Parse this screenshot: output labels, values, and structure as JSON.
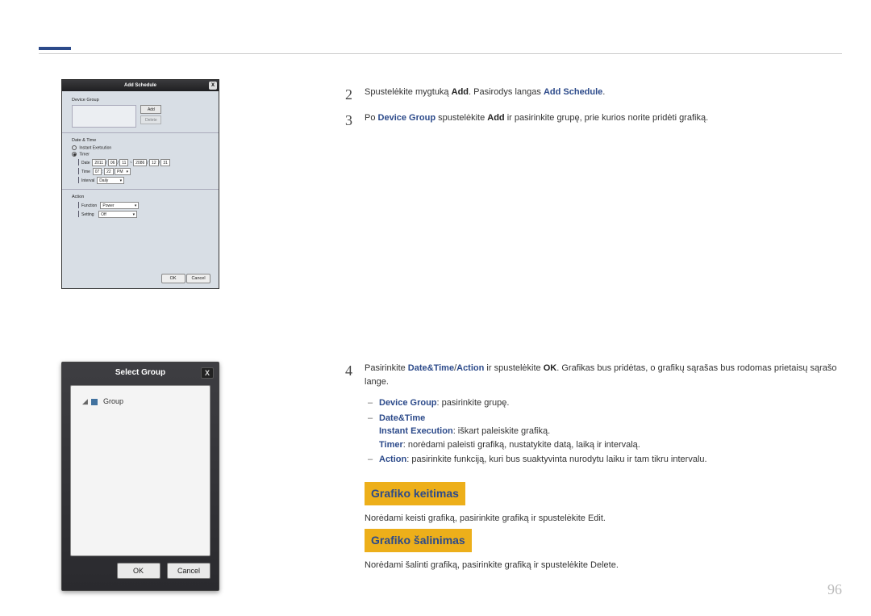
{
  "page_number": "96",
  "figure1": {
    "title": "Add Schedule",
    "close": "X",
    "device_group_label": "Device Group",
    "add_btn": "Add",
    "delete_btn": "Delete",
    "datetime_label": "Date & Time",
    "instant_label": "Instant Exetcution",
    "timer_label": "Timer",
    "date_label": "Date",
    "date_y1": "2011",
    "date_m1": "06",
    "date_d1": "11",
    "date_sep": "~",
    "date_y2": "2086",
    "date_m2": "12",
    "date_d2": "31",
    "time_label": "Time",
    "time_h": "07",
    "time_m": "22",
    "time_ampm": "PM",
    "interval_label": "Interval",
    "interval_val": "Daily",
    "action_label": "Action",
    "function_label": "Function",
    "function_val": "Power",
    "setting_label": "Setting",
    "setting_val": "Off",
    "ok": "OK",
    "cancel": "Cancel"
  },
  "figure2": {
    "title": "Select Group",
    "close": "X",
    "root": "Group",
    "ok": "OK",
    "cancel": "Cancel"
  },
  "step2": {
    "num": "2",
    "t1": "Spustelėkite mygtuką ",
    "b1": "Add",
    "t2": ". Pasirodys langas ",
    "b2": "Add Schedule",
    "t3": "."
  },
  "step3": {
    "num": "3",
    "t1": "Po ",
    "b1": "Device Group",
    "t2": " spustelėkite ",
    "b2": "Add",
    "t3": " ir pasirinkite grupę, prie kurios norite pridėti grafiką."
  },
  "step4": {
    "num": "4",
    "t1": "Pasirinkite ",
    "b1": "Date&Time",
    "sep1": "/",
    "b2": "Action",
    "t2": " ir spustelėkite ",
    "k1": "OK",
    "t3": ". Grafikas bus pridėtas, o grafikų sąrašas bus rodomas prietaisų sąrašo lange.",
    "bullet1_b": "Device Group",
    "bullet1_t": ": pasirinkite grupę.",
    "bullet2_b": "Date&Time",
    "bullet2_sub1_b": "Instant Execution",
    "bullet2_sub1_t": ": iškart paleiskite grafiką.",
    "bullet2_sub2_b": "Timer",
    "bullet2_sub2_t": ": norėdami paleisti grafiką, nustatykite datą, laiką ir intervalą.",
    "bullet3_b": "Action",
    "bullet3_t": ": pasirinkite funkciją, kuri bus suaktyvinta nurodytu laiku ir tam tikru intervalu."
  },
  "section_edit": {
    "heading": "Grafiko keitimas",
    "t1": "Norėdami keisti grafiką, pasirinkite grafiką ir spustelėkite ",
    "b1": "Edit",
    "t2": "."
  },
  "section_delete": {
    "heading": "Grafiko šalinimas",
    "t1": "Norėdami šalinti grafiką, pasirinkite grafiką ir spustelėkite ",
    "b1": "Delete",
    "t2": "."
  }
}
